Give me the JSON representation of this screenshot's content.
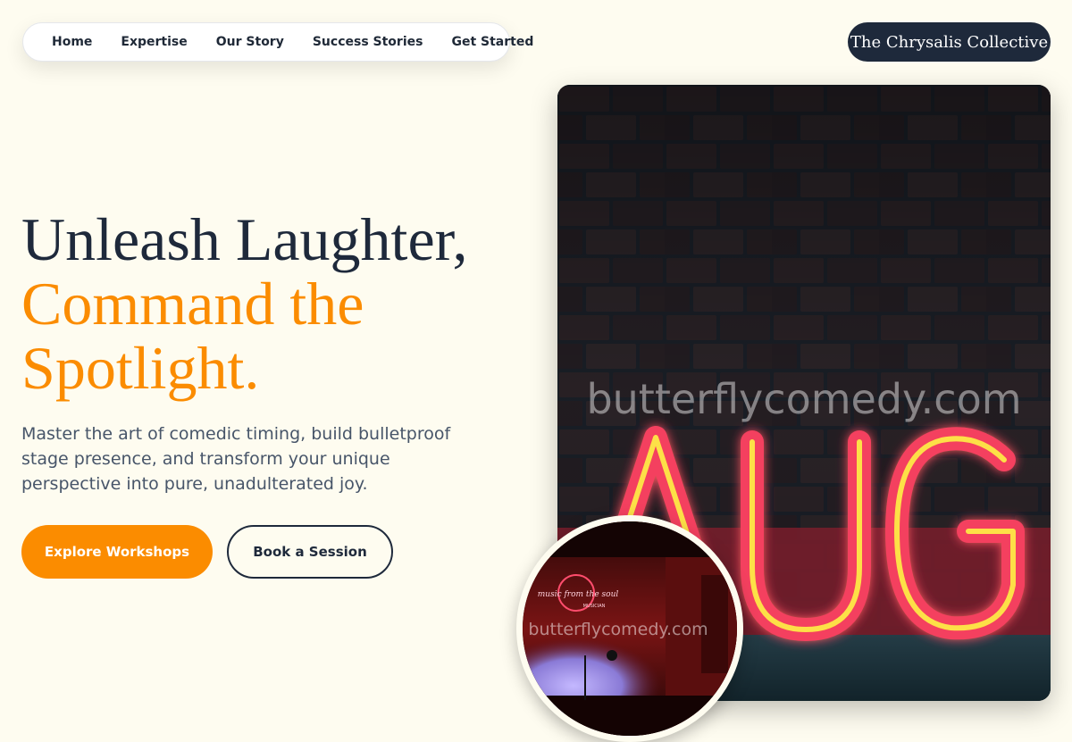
{
  "nav": {
    "items": [
      {
        "label": "Home"
      },
      {
        "label": "Expertise"
      },
      {
        "label": "Our Story"
      },
      {
        "label": "Success Stories"
      },
      {
        "label": "Get Started"
      }
    ]
  },
  "brand": {
    "label": "The Chrysalis Collective"
  },
  "hero": {
    "headline_line1": "Unleash Laughter,",
    "headline_line2": "Command the",
    "headline_line3": "Spotlight.",
    "subtitle": "Master the art of comedic timing, build bulletproof stage presence, and transform your unique perspective into pure, unadulterated joy.",
    "primary_button": "Explore Workshops",
    "secondary_button": "Book a Session"
  },
  "images": {
    "main_watermark": "butterflycomedy.com",
    "main_neon_text": "AUG",
    "circle_watermark": "butterflycomedy.com",
    "circle_neon_text": "music from the soul",
    "circle_neon_subtext": "MUSICIAN"
  },
  "colors": {
    "background": "#fefcf0",
    "accent": "#fb8c00",
    "dark": "#1e293b",
    "muted_text": "#475569"
  }
}
